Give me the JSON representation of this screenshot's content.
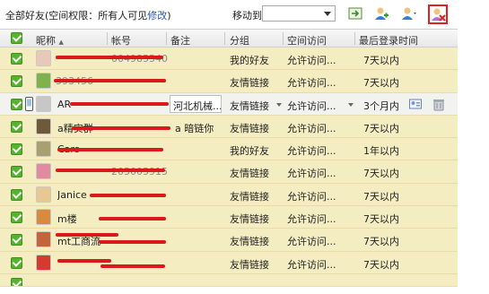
{
  "toolbar": {
    "title_prefix": "全部好友(空间权限：所有人可见",
    "title_link": "修改",
    "title_suffix": ")",
    "move_to_label": "移动到",
    "move_to_value": ""
  },
  "columns": [
    "昵称",
    "帐号",
    "备注",
    "分组",
    "空间访问",
    "最后登录时间"
  ],
  "sort_indicator": "▲",
  "rows": [
    {
      "nickname": "",
      "account": "004985540",
      "remark": "",
      "group": "我的好友",
      "access": "允许访问...",
      "last_login": "7天以内",
      "avatar_color": "#e8c9b8",
      "selected": false
    },
    {
      "nickname": "",
      "account": "393456",
      "remark": "",
      "group": "友情链接",
      "access": "允许访问...",
      "last_login": "7天以内",
      "avatar_color": "#7fb24a",
      "selected": false
    },
    {
      "nickname": "AR",
      "account": "",
      "remark": "河北机械...",
      "group": "友情链接",
      "access": "允许访问...",
      "last_login": "3个月内",
      "avatar_color": "#c7c7c7",
      "selected": true
    },
    {
      "nickname": "a精实群",
      "account": "",
      "remark": "a 暗链你",
      "group": "友情链接",
      "access": "允许访问...",
      "last_login": "7天以内",
      "avatar_color": "#6e5a3a",
      "selected": false
    },
    {
      "nickname": "Cars",
      "account": "",
      "remark": "",
      "group": "我的好友",
      "access": "允许访问...",
      "last_login": "1年以内",
      "avatar_color": "#a8a070",
      "selected": false
    },
    {
      "nickname": "",
      "account": "205005915",
      "remark": "",
      "group": "友情链接",
      "access": "允许访问...",
      "last_login": "7天以内",
      "avatar_color": "#e28aa0",
      "selected": false
    },
    {
      "nickname": "Janice",
      "account": "",
      "remark": "",
      "group": "友情链接",
      "access": "允许访问...",
      "last_login": "7天以内",
      "avatar_color": "#e7c890",
      "selected": false
    },
    {
      "nickname": "m楼",
      "account": "",
      "remark": "",
      "group": "友情链接",
      "access": "允许访问...",
      "last_login": "7天以内",
      "avatar_color": "#d98a3c",
      "selected": false
    },
    {
      "nickname": "mt工商流",
      "account": "",
      "remark": "",
      "group": "友情链接",
      "access": "允许访问...",
      "last_login": "7天以内",
      "avatar_color": "#c5643c",
      "selected": false
    },
    {
      "nickname": "",
      "account": "",
      "remark": "",
      "group": "友情链接",
      "access": "允许访问...",
      "last_login": "7天以内",
      "avatar_color": "#d33b2e",
      "selected": false
    }
  ],
  "colors": {
    "row_bg": "#f4edc2",
    "selected_row_bg": "#f2f2ee",
    "checkbox": "#57b22f",
    "redaction": "#d81a1a",
    "link": "#2a56a8"
  },
  "icons": [
    "move-to-icon",
    "add-friend-icon",
    "manage-friend-icon",
    "delete-friend-icon",
    "edit-card-icon",
    "trash-icon"
  ]
}
